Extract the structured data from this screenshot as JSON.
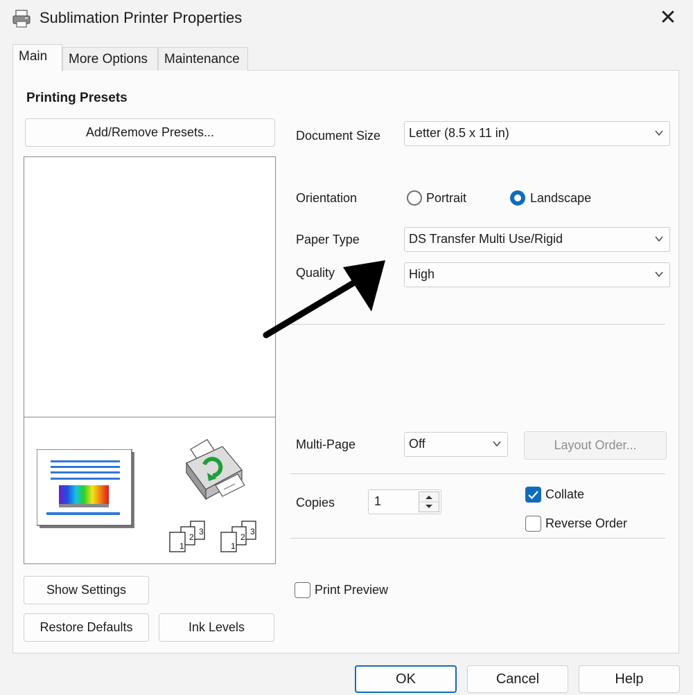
{
  "window": {
    "title": "Sublimation Printer Properties",
    "close_glyph": "✕",
    "icon": "printer-icon"
  },
  "tabs": [
    {
      "label": "Main",
      "active": true
    },
    {
      "label": "More Options",
      "active": false
    },
    {
      "label": "Maintenance",
      "active": false
    }
  ],
  "presets": {
    "heading": "Printing Presets",
    "add_remove_label": "Add/Remove Presets..."
  },
  "preview": {
    "page_icon": "page-preview-icon",
    "printer_icon": "printer-feed-icon",
    "collate_icons": [
      "collate-stack-icon",
      "collate-stack-icon"
    ],
    "page_numbers": [
      "1",
      "2",
      "3"
    ]
  },
  "document_size": {
    "label": "Document Size",
    "value": "Letter (8.5 x 11 in)"
  },
  "orientation": {
    "label": "Orientation",
    "options": [
      {
        "label": "Portrait",
        "selected": false
      },
      {
        "label": "Landscape",
        "selected": true
      }
    ]
  },
  "paper_type": {
    "label": "Paper Type",
    "value": "DS Transfer Multi Use/Rigid"
  },
  "quality": {
    "label": "Quality",
    "value": "High"
  },
  "multi_page": {
    "label": "Multi-Page",
    "value": "Off",
    "layout_order_label": "Layout Order...",
    "layout_order_enabled": false
  },
  "copies": {
    "label": "Copies",
    "value": "1"
  },
  "collate": {
    "label": "Collate",
    "checked": true
  },
  "reverse_order": {
    "label": "Reverse Order",
    "checked": false
  },
  "print_preview": {
    "label": "Print Preview",
    "checked": false
  },
  "buttons": {
    "show_settings": "Show Settings",
    "restore_defaults": "Restore Defaults",
    "ink_levels": "Ink Levels",
    "ok": "OK",
    "cancel": "Cancel",
    "help": "Help"
  },
  "annotation": {
    "type": "arrow",
    "color": "#000000",
    "points_to": "quality"
  },
  "colors": {
    "accent": "#0f6cbd",
    "panel": "#fbfbfb",
    "window": "#f3f3f3"
  }
}
